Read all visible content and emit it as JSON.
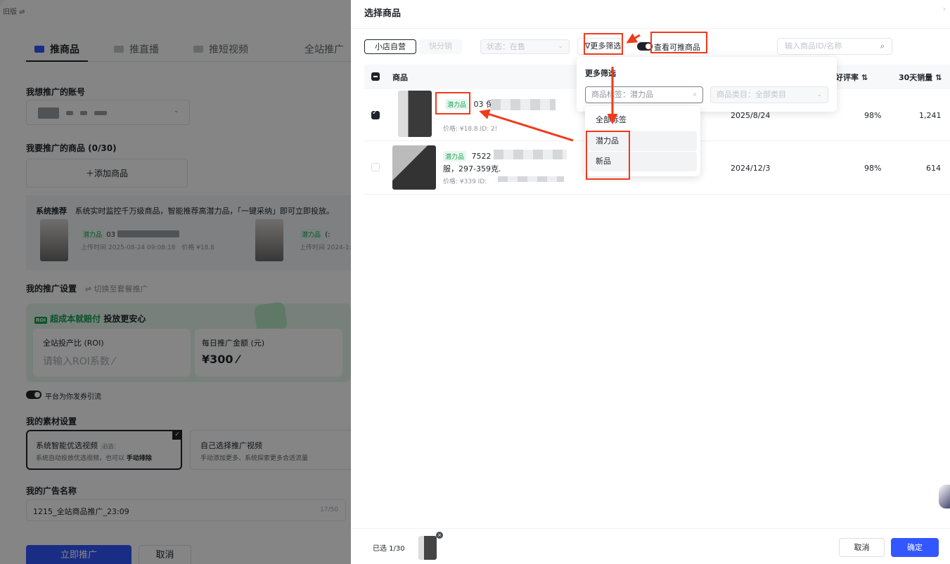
{
  "left": {
    "old_version": "旧版 ⇌",
    "tabs": [
      {
        "label": "推商品",
        "active": true
      },
      {
        "label": "推直播",
        "active": false
      },
      {
        "label": "推短视频",
        "active": false
      },
      {
        "label": "全站推广",
        "active": false
      }
    ],
    "account_title": "我想推广的账号",
    "products_title": "我要推广的商品 (0/30)",
    "add_product": "＋添加商品",
    "rec_label": "系统推荐",
    "rec_desc": "系统实时监控千万级商品，智能推荐高潜力品，「一键采纳」即可立即投放。",
    "rec_items": [
      {
        "tag": "潜力品",
        "code": "03",
        "meta": "上传时间 2025-08-24 09:08:18",
        "price": "价格 ¥18.8"
      },
      {
        "tag": "潜力品",
        "code": "(:",
        "meta": "上传时间 2024-1:",
        "price": ""
      }
    ],
    "settings_title": "我的推广设置",
    "switch_link": "⇌ 切换至套餐推广",
    "roi_badge": "ROI",
    "roi_banner": "超成本就赔付",
    "roi_banner2": "投放更安心",
    "roi_label": "全站投产比 (ROI)",
    "roi_placeholder": "请输入ROI系数 ⁄",
    "budget_label": "每日推广金额 (元)",
    "budget_value": "¥300 ⁄",
    "coupon_toggle": "平台为你发券引流",
    "material_title": "我的素材设置",
    "mat1_title": "系统智能优选视频",
    "mat1_badge": "必选",
    "mat1_desc": "系统自动投放优选视频，也可以",
    "mat1_link": "手动排除",
    "mat2_title": "自己选择推广视频",
    "mat2_desc": "手动添加更多、系统探索更多合适流量",
    "name_title": "我的广告名称",
    "name_value": "1215_全站商品推广_23:09",
    "name_count": "17/50",
    "launch_btn": "立即推广",
    "cancel_btn": "取消"
  },
  "drawer": {
    "title": "选择商品",
    "seg": [
      "小店自营",
      "快分销"
    ],
    "status_select": "状态：在售",
    "more_filter": "更多筛选",
    "toggle_label": "查看可推商品",
    "search_placeholder": "输入商品ID/名称",
    "columns": {
      "product": "商品",
      "rating": "好评率 ⇅",
      "sales": "30天销量 ⇅"
    },
    "rows": [
      {
        "tag": "潜力品",
        "name": "03 保",
        "price": "价格: ¥18.8   ID: 2!",
        "date": "2025/8/24",
        "rating": "98%",
        "sales": "1,241",
        "checked": true
      },
      {
        "tag": "潜力品",
        "name": "7522",
        "name2": "服，297-359克.",
        "price": "价格: ¥339   ID:",
        "date": "2024/12/3",
        "rating": "98%",
        "sales": "614",
        "checked": false
      }
    ],
    "popover": {
      "title": "更多筛选",
      "tag_input": "商品标签：潜力品",
      "category": "商品类目：全部类目"
    },
    "dropdown": [
      "全部标签",
      "潜力品",
      "新品"
    ],
    "selected_count": "已选 1/30",
    "cancel": "取消",
    "confirm": "确定"
  },
  "colors": {
    "primary": "#3357ff",
    "annotation": "#f03a1c",
    "potential_tag": "#12a150"
  }
}
